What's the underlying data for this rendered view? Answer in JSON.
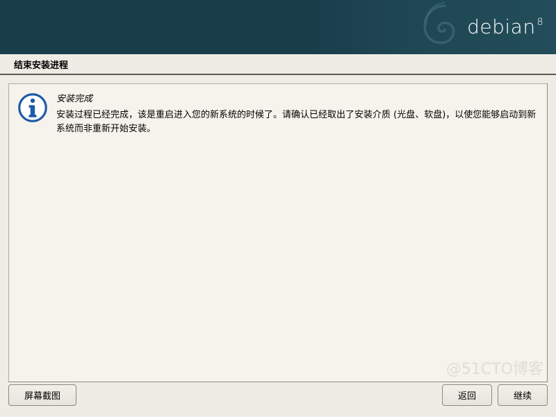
{
  "brand": {
    "name": "debian",
    "version": "8"
  },
  "header": {
    "title": "结束安装进程"
  },
  "message": {
    "title": "安装完成",
    "body": "安装过程已经完成，该是重启进入您的新系统的时候了。请确认已经取出了安装介质 (光盘、软盘)，以使您能够启动到新系统而非重新开始安装。"
  },
  "buttons": {
    "screenshot": "屏幕截图",
    "back": "返回",
    "continue": "继续"
  },
  "watermark": "@51CTO博客"
}
